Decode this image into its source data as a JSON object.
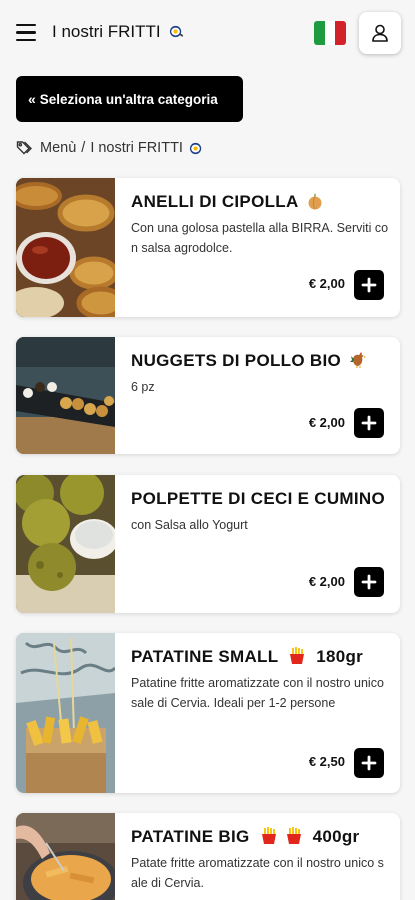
{
  "header": {
    "title": "I nostri FRITTI",
    "flag_colors": [
      "#1e9b3e",
      "#ffffff",
      "#d2232a"
    ]
  },
  "category_button": {
    "label": "Seleziona un'altra categoria"
  },
  "breadcrumb": {
    "home": "Menù",
    "separator": "/",
    "current": "I nostri FRITTI"
  },
  "products": [
    {
      "name": "ANELLI DI CIPOLLA",
      "name_emoji": "onion-icon",
      "description": "Con una golosa pastella alla BIRRA. Serviti con salsa agrodolce.",
      "price": "€ 2,00"
    },
    {
      "name": "NUGGETS DI POLLO BIO",
      "name_emoji": "rooster-icon",
      "description": "6 pz",
      "price": "€ 2,00"
    },
    {
      "name": "POLPETTE DI CECI E CUMINO",
      "description": "con Salsa allo Yogurt",
      "price": "€ 2,00"
    },
    {
      "name": "PATATINE SMALL",
      "name_suffix": "180gr",
      "description": "Patatine fritte aromatizzate con il nostro unico sale di Cervia. Ideali per 1-2 persone",
      "price": "€ 2,50"
    },
    {
      "name": "PATATINE BIG",
      "name_suffix": "400gr",
      "description": "Patate fritte aromatizzate con il nostro unico sale di Cervia.",
      "price": ""
    }
  ]
}
